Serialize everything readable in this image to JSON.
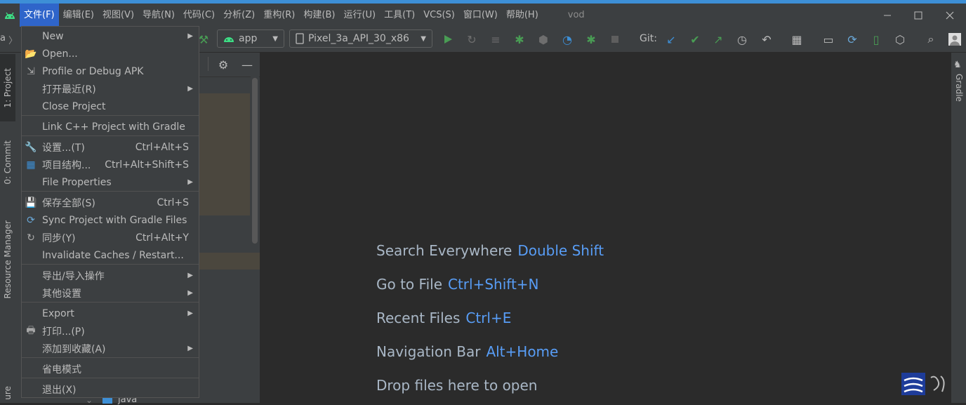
{
  "menubar": {
    "items": [
      "文件(F)",
      "编辑(E)",
      "视图(V)",
      "导航(N)",
      "代码(C)",
      "分析(Z)",
      "重构(R)",
      "构建(B)",
      "运行(U)",
      "工具(T)",
      "VCS(S)",
      "窗口(W)",
      "帮助(H)"
    ],
    "project_name": "vod"
  },
  "toolbar": {
    "run_config": "app",
    "device": "Pixel_3a_API_30_x86",
    "git_label": "Git:"
  },
  "left_tabs": {
    "project": "1: Project",
    "commit": "0: Commit",
    "resource_manager": "Resource Manager",
    "structure": "ure"
  },
  "right_tabs": {
    "gradle": "Gradle"
  },
  "breadcrumb": {
    "left": "a"
  },
  "project_tree": {
    "partial_item": "java"
  },
  "file_menu": {
    "items": [
      {
        "label": "New",
        "shortcut": "",
        "submenu": true
      },
      {
        "label": "Open...",
        "shortcut": "",
        "submenu": false
      },
      {
        "label": "Profile or Debug APK",
        "shortcut": "",
        "submenu": false
      },
      {
        "label": "打开最近(R)",
        "shortcut": "",
        "submenu": true
      },
      {
        "label": "Close Project",
        "shortcut": "",
        "submenu": false
      },
      {
        "label": "Link C++ Project with Gradle",
        "shortcut": "",
        "submenu": false
      },
      {
        "label": "设置...(T)",
        "shortcut": "Ctrl+Alt+S",
        "submenu": false
      },
      {
        "label": "项目结构...",
        "shortcut": "Ctrl+Alt+Shift+S",
        "submenu": false
      },
      {
        "label": "File Properties",
        "shortcut": "",
        "submenu": true
      },
      {
        "label": "保存全部(S)",
        "shortcut": "Ctrl+S",
        "submenu": false
      },
      {
        "label": "Sync Project with Gradle Files",
        "shortcut": "",
        "submenu": false
      },
      {
        "label": "同步(Y)",
        "shortcut": "Ctrl+Alt+Y",
        "submenu": false
      },
      {
        "label": "Invalidate Caches / Restart...",
        "shortcut": "",
        "submenu": false
      },
      {
        "label": "导出/导入操作",
        "shortcut": "",
        "submenu": true
      },
      {
        "label": "其他设置",
        "shortcut": "",
        "submenu": true
      },
      {
        "label": "Export",
        "shortcut": "",
        "submenu": true
      },
      {
        "label": "打印...(P)",
        "shortcut": "",
        "submenu": false
      },
      {
        "label": "添加到收藏(A)",
        "shortcut": "",
        "submenu": true
      },
      {
        "label": "省电模式",
        "shortcut": "",
        "submenu": false
      },
      {
        "label": "退出(X)",
        "shortcut": "",
        "submenu": false
      }
    ]
  },
  "editor_hints": [
    {
      "label": "Search Everywhere",
      "key": "Double Shift"
    },
    {
      "label": "Go to File",
      "key": "Ctrl+Shift+N"
    },
    {
      "label": "Recent Files",
      "key": "Ctrl+E"
    },
    {
      "label": "Navigation Bar",
      "key": "Alt+Home"
    },
    {
      "label": "Drop files here to open",
      "key": ""
    }
  ],
  "colors": {
    "accent": "#2f65ca",
    "shortcut_blue": "#589df6",
    "run_green": "#499c54",
    "android_green": "#3ddc84"
  }
}
